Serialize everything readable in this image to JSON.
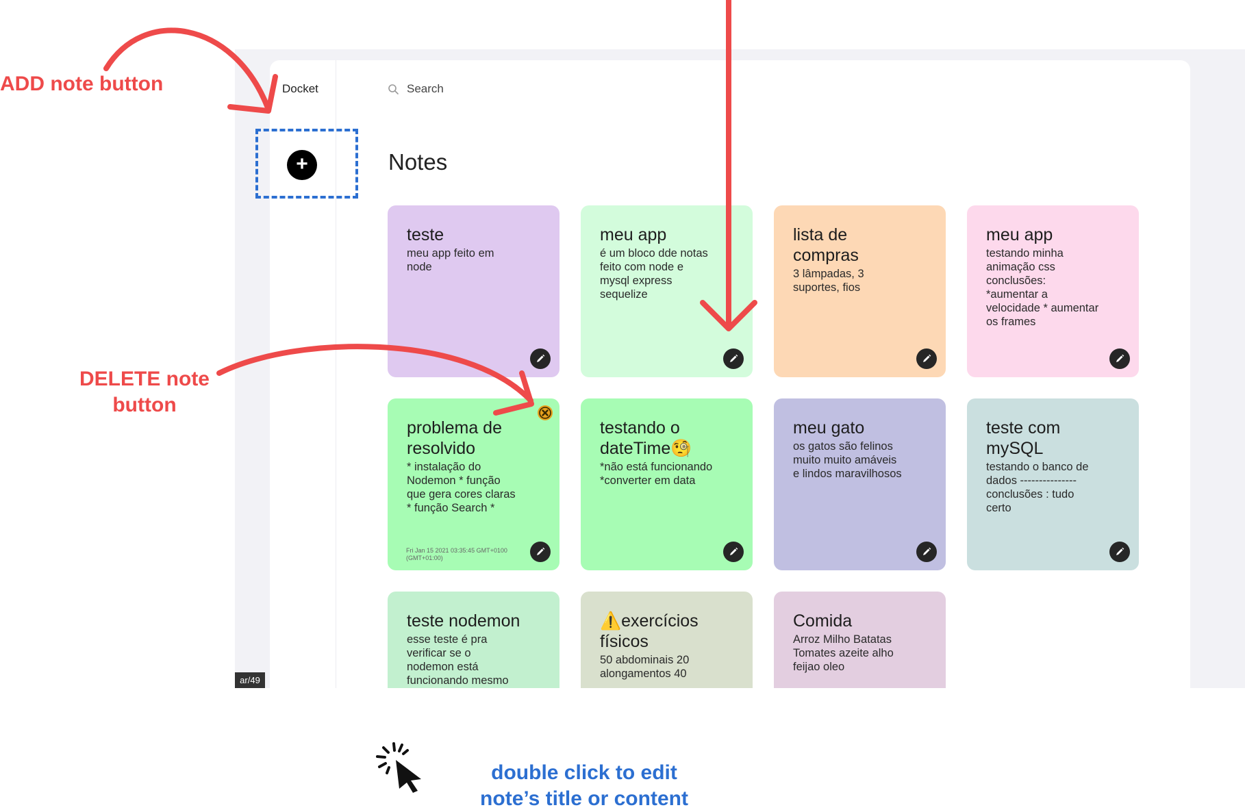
{
  "app": {
    "name": "Docket",
    "search_label": "Search",
    "page_title": "Notes",
    "add_button_symbol": "+",
    "url_fragment": "ar/49"
  },
  "annotations": {
    "add_label": "ADD note button",
    "delete_label_line1": "DELETE note",
    "delete_label_line2": "button",
    "dblclick_line1": "double click to edit",
    "dblclick_line2": "note’s title or content"
  },
  "notes": [
    {
      "title": "teste",
      "content": "meu app feito em\nnode",
      "color": "#dfc9f0"
    },
    {
      "title": "meu app",
      "content": "é um bloco dde notas\nfeito com node e\nmysql express\nsequelize",
      "color": "#d3fcdc"
    },
    {
      "title": "lista de\ncompras",
      "content": "3 lâmpadas, 3\nsuportes, fios",
      "color": "#fdd8b5"
    },
    {
      "title": "meu app",
      "content": "testando minha\nanimação css\nconclusões:\n*aumentar a\nvelocidade * aumentar\nos frames",
      "color": "#fdd9ec"
    },
    {
      "title": "problema de\nresolvido",
      "content": "* instalação do\nNodemon * função\nque gera cores claras\n* função Search *",
      "date": "Fri Jan 15 2021 03:35:45 GMT+0100 (GMT+01:00)",
      "color": "#a7fcb4"
    },
    {
      "title": "testando o\ndateTime🧐",
      "content": "*não está funcionando\n*converter em data",
      "color": "#a7fcb4"
    },
    {
      "title": "meu gato",
      "content": "os gatos são felinos\nmuito muito amáveis\ne lindos maravilhosos",
      "color": "#c0bfe1"
    },
    {
      "title": "teste com\nmySQL",
      "content": "testando o banco de\ndados ---------------\nconclusões : tudo\ncerto",
      "color": "#cadfdf"
    },
    {
      "title": "teste nodemon",
      "content": "esse teste é pra\nverificar se o\nnodemon está\nfuncionando mesmo",
      "color": "#c2f0cf"
    },
    {
      "title": "⚠️exercícios\nfísicos",
      "content": "50 abdominais 20\nalongamentos 40",
      "color": "#d9e0cd"
    },
    {
      "title": "Comida",
      "content": "Arroz Milho Batatas\nTomates azeite alho\nfeijao oleo",
      "color": "#e3cee0"
    }
  ],
  "icons": {
    "edit": "pencil-icon",
    "delete": "close-icon",
    "search": "search-icon",
    "cursor": "click-cursor-icon"
  },
  "colors": {
    "annotation_red": "#ee4a4a",
    "annotation_blue": "#2c6fd1",
    "delete_button": "#e8a01d"
  }
}
